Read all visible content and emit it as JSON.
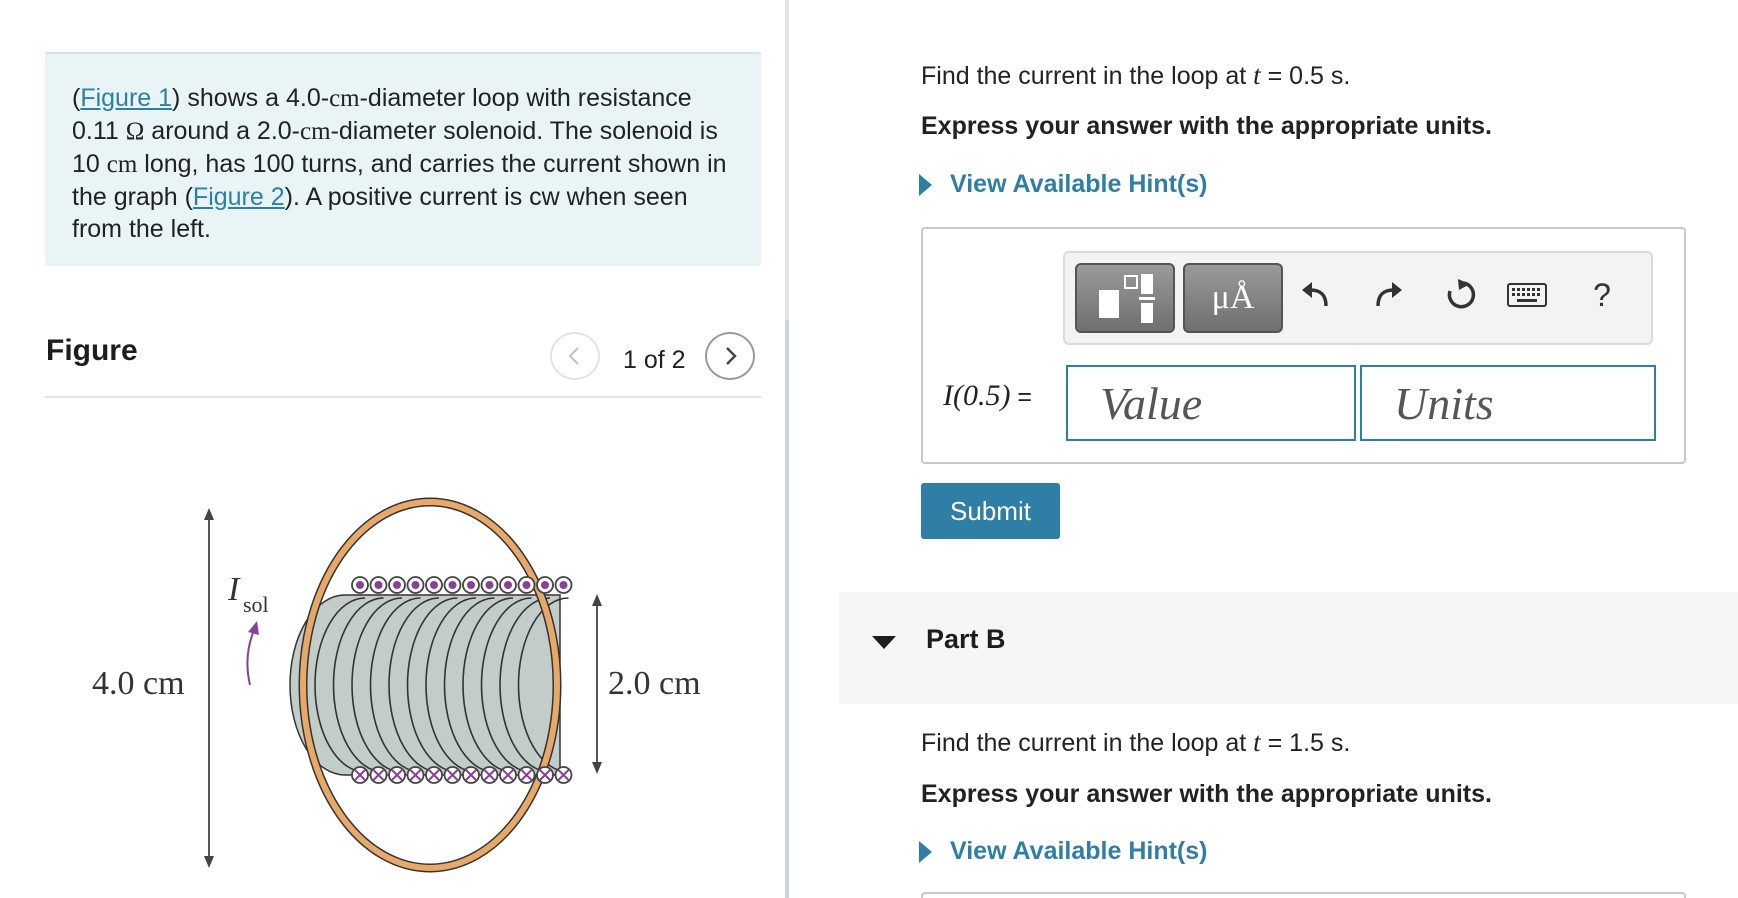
{
  "problem": {
    "figure1_link": "Figure 1",
    "text_1": ") shows a 4.0-",
    "unit_cm": "cm",
    "text_2": "-diameter loop with resistance 0.11 ",
    "unit_ohm": "Ω",
    "text_3": " around a 2.0-",
    "text_4": "-diameter solenoid.  The solenoid is 10 ",
    "text_5": " long, has 100 turns, and carries the current shown in the graph (",
    "figure2_link": "Figure 2",
    "text_6": "). A positive current is cw when seen from the left."
  },
  "figure": {
    "title": "Figure",
    "counter": "1 of 2",
    "labels": {
      "loop_diameter": "4.0 cm",
      "solenoid_diameter": "2.0 cm",
      "current_symbol": "I",
      "current_subscript": "sol"
    },
    "colors": {
      "loop": "#e8a968",
      "solenoid_body": "#c2ccc9",
      "wire_dot": "#8a3f9a"
    }
  },
  "part_a": {
    "question_prefix": "Find the current in the loop at ",
    "question_var": "t",
    "question_suffix": " = 0.5 s.",
    "instruction": "Express your answer with the appropriate units.",
    "hint_label": "View Available Hint(s)",
    "answer_label_func": "I(0.5)",
    "answer_label_eq": " =",
    "value_placeholder": "Value",
    "units_placeholder": "Units",
    "units_tool": "μÅ",
    "help_tool": "?",
    "submit_label": "Submit"
  },
  "part_b": {
    "title": "Part B",
    "question_prefix": "Find the current in the loop at ",
    "question_var": "t",
    "question_suffix": " = 1.5 s.",
    "instruction": "Express your answer with the appropriate units.",
    "hint_label": "View Available Hint(s)"
  },
  "theme": {
    "accent": "#2f7ea6",
    "problem_bg": "#e8f4f6"
  }
}
